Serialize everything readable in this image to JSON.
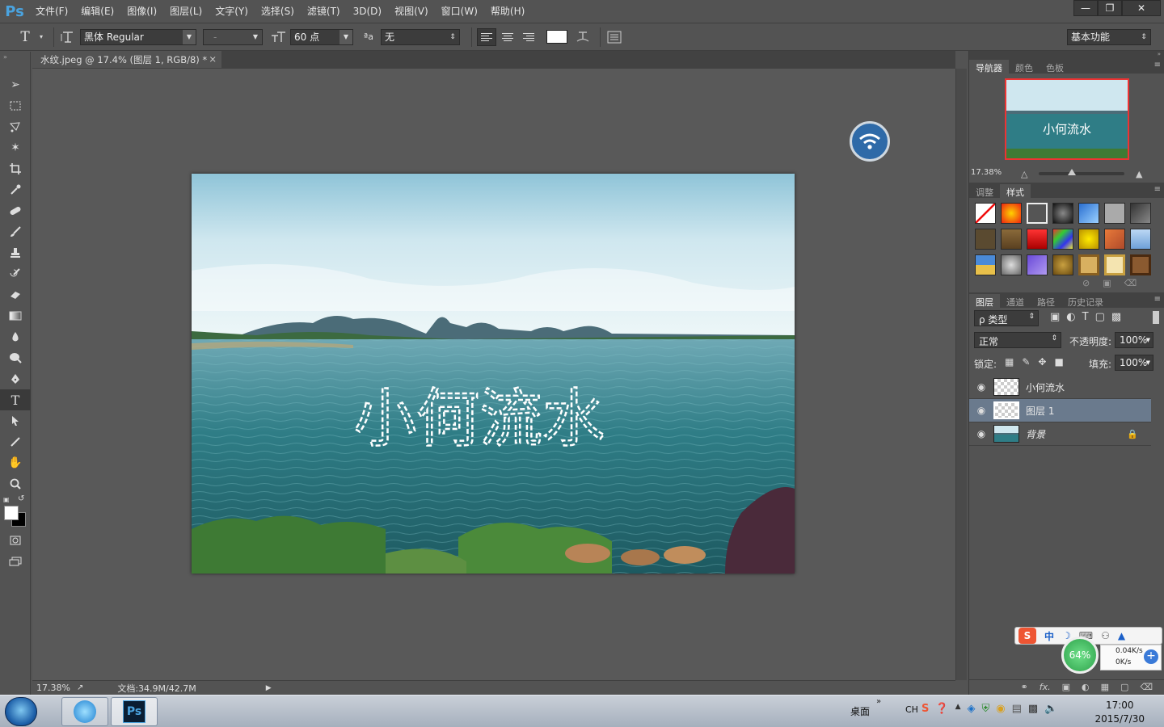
{
  "app": {
    "logo": "Ps",
    "menu": [
      "文件(F)",
      "编辑(E)",
      "图像(I)",
      "图层(L)",
      "文字(Y)",
      "选择(S)",
      "滤镜(T)",
      "3D(D)",
      "视图(V)",
      "窗口(W)",
      "帮助(H)"
    ]
  },
  "options": {
    "font_family": "黑体 Regular",
    "font_style": "-",
    "font_size": "60 点",
    "aa_label": "ªa",
    "aa_mode": "无",
    "workspace": "基本功能",
    "text_color": "#ffffff"
  },
  "document": {
    "tab_title": "水纹.jpeg @ 17.4% (图层 1, RGB/8) *",
    "overlay_text": "小何流水",
    "zoom": "17.38%",
    "doc_size": "文档:34.9M/42.7M"
  },
  "navigator": {
    "tabs": [
      "导航器",
      "颜色",
      "色板"
    ],
    "zoom": "17.38%",
    "thumb_text": "小何流水"
  },
  "styles": {
    "tabs": [
      "调整",
      "样式"
    ]
  },
  "layers": {
    "tabs": [
      "图层",
      "通道",
      "路径",
      "历史记录"
    ],
    "filter": "ρ 类型",
    "blend_mode": "正常",
    "opacity_label": "不透明度:",
    "opacity": "100%",
    "lock_label": "锁定:",
    "fill_label": "填充:",
    "fill": "100%",
    "items": [
      {
        "name": "小何流水",
        "selected": false
      },
      {
        "name": "图层 1",
        "selected": true
      },
      {
        "name": "背景",
        "selected": false
      }
    ]
  },
  "sogou": {
    "percent": "64%",
    "up": "0.04K/s",
    "down": "0K/s",
    "mode": "中"
  },
  "taskbar": {
    "desktop": "桌面",
    "lang": "CH",
    "time": "17:00",
    "date": "2015/7/30"
  }
}
